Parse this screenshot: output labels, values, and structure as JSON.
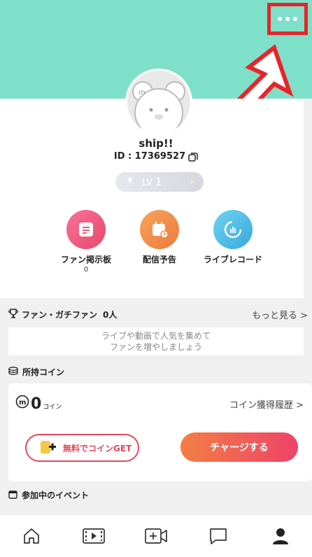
{
  "header": {
    "background_color": "#7fe0c9",
    "more_menu_icon": "more-horizontal-icon",
    "highlight_color": "#e8242a"
  },
  "profile": {
    "username": "ship!!",
    "id_label": "ID : 17369527",
    "level_label": "LV",
    "level_value": "1"
  },
  "menu": [
    {
      "label": "ファン掲示板",
      "count": "0",
      "icon": "board-icon",
      "color": "#ee5b7c"
    },
    {
      "label": "配信予告",
      "count": "",
      "icon": "calendar-icon",
      "color": "#f08a4b"
    },
    {
      "label": "ライブレコード",
      "count": "",
      "icon": "record-icon",
      "color": "#45b9e4"
    }
  ],
  "fans": {
    "title": "ファン・ガチファン",
    "count": "0人",
    "more_label": "もっと見る >",
    "empty_line1": "ライブや動画で人気を集めて",
    "empty_line2": "ファンを増やしましょう"
  },
  "coins": {
    "title": "所持コイン",
    "amount": "0",
    "unit": "コイン",
    "history_label": "コイン獲得履歴 >",
    "free_button": "無料でコインGET",
    "charge_button": "チャージする"
  },
  "events": {
    "title": "参加中のイベント"
  },
  "tabs": [
    {
      "name": "home",
      "icon": "home-icon"
    },
    {
      "name": "videos",
      "icon": "video-list-icon"
    },
    {
      "name": "broadcast",
      "icon": "add-video-icon"
    },
    {
      "name": "messages",
      "icon": "chat-icon"
    },
    {
      "name": "profile",
      "icon": "person-icon"
    }
  ]
}
